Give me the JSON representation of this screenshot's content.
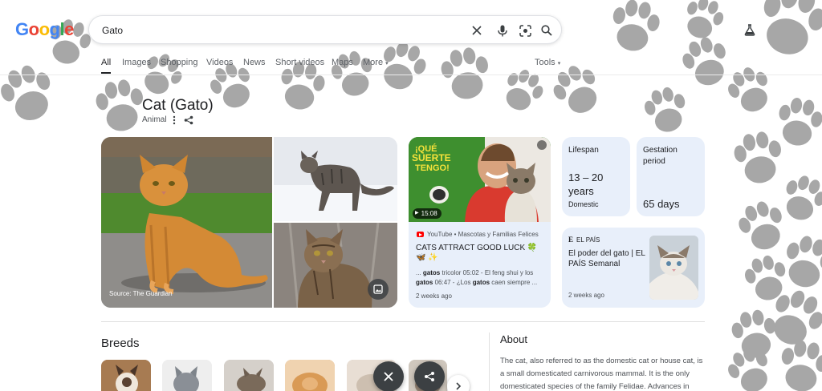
{
  "header": {
    "logo_letters": [
      {
        "ch": "G",
        "color": "#4285F4"
      },
      {
        "ch": "o",
        "color": "#EA4335"
      },
      {
        "ch": "o",
        "color": "#FBBC05"
      },
      {
        "ch": "g",
        "color": "#4285F4"
      },
      {
        "ch": "l",
        "color": "#34A853"
      },
      {
        "ch": "e",
        "color": "#EA4335"
      }
    ],
    "search_value": "Gato",
    "icons": [
      "clear-icon",
      "microphone-icon",
      "lens-icon",
      "search-icon",
      "labs-flask-icon"
    ]
  },
  "tabs": {
    "all": "All",
    "images": "Images",
    "shopping": "Shopping",
    "videos": "Videos",
    "news": "News",
    "short_videos": "Short videos",
    "maps": "Maps",
    "more": "More",
    "tools": "Tools"
  },
  "knowledge_panel": {
    "title": "Cat (Gato)",
    "subtitle": "Animal",
    "image_source": "Source: The Guardian"
  },
  "video": {
    "thumb_text_1": "¡QUÉ",
    "thumb_text_2": "SUERTE",
    "thumb_text_3": "TENGO!",
    "duration": "15:08",
    "source": "YouTube • Mascotas y Familias Felices",
    "title": "CATS ATTRACT GOOD LUCK 🍀 🦋 ✨",
    "snippet_1_pre": "... ",
    "snippet_1_bold": "gatos",
    "snippet_1_post": " tricolor 05:02 - El feng shui y los",
    "snippet_2_bold": "gatos",
    "snippet_2_mid": " 06:47 - ¿Los ",
    "snippet_2_bold2": "gatos",
    "snippet_2_post": " caen siempre ...",
    "time": "2 weeks ago"
  },
  "facts": {
    "lifespan_label": "Lifespan",
    "lifespan_value": "13 – 20 years",
    "lifespan_sub": "Domestic",
    "gestation_label": "Gestation period",
    "gestation_value": "65 days"
  },
  "news": {
    "logo": "E",
    "source": "EL PAÍS",
    "title": "El poder del gato | EL PAÍS Semanal",
    "time": "2 weeks ago"
  },
  "breeds": {
    "title": "Breeds"
  },
  "about": {
    "title": "About",
    "text": "The cat, also referred to as the domestic cat or house cat, is a small domesticated carnivorous mammal. It is the only domesticated species of the family Felidae. Advances in"
  },
  "colors": {
    "accent_blue": "#1a73e8",
    "card_bg": "#e8effa",
    "youtube_red": "#ff0000",
    "fab_bg": "#3c4043"
  }
}
